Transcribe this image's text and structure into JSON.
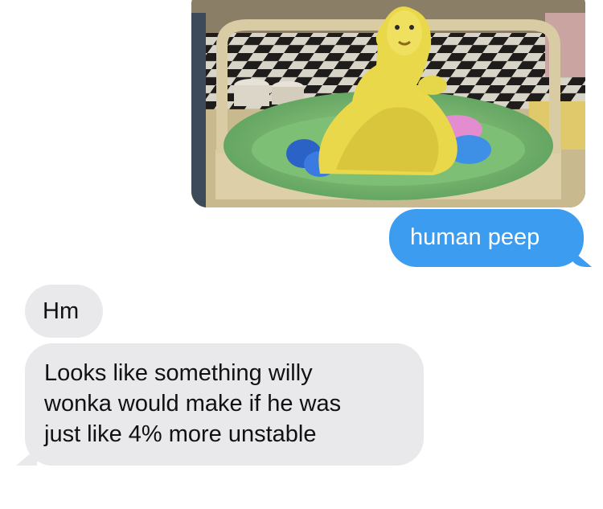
{
  "conversation": {
    "attachment": {
      "icon": "photo-attachment"
    },
    "sent": {
      "text": "human peep",
      "color": "#3b9cf0"
    },
    "received": [
      {
        "lines": [
          "Hm"
        ]
      },
      {
        "lines": [
          "Looks like something willy",
          "wonka would make if he was",
          "just like 4% more unstable"
        ]
      }
    ],
    "received_color": "#e9e9ec"
  }
}
